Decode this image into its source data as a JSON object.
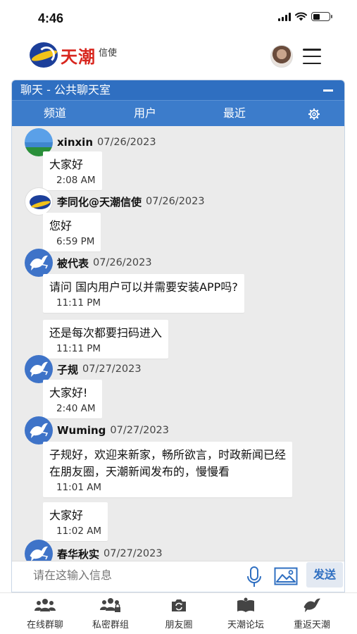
{
  "status_bar": {
    "time": "4:46"
  },
  "header": {
    "logo_text": "天潮",
    "logo_sub": "信使"
  },
  "panel": {
    "title": "聊天 - 公共聊天室",
    "tabs": [
      {
        "label": "频道"
      },
      {
        "label": "用户"
      },
      {
        "label": "最近"
      }
    ]
  },
  "messages": [
    {
      "author": "xinxin",
      "date": "07/26/2023",
      "text": "大家好",
      "time": "2:08 AM",
      "avatar": "landscape-avatar"
    },
    {
      "author": "李同化@天潮信使",
      "date": "07/26/2023",
      "text": "您好",
      "time": "6:59 PM",
      "avatar": "tianchao-logo-avatar"
    },
    {
      "author": "被代表",
      "date": "07/26/2023",
      "text": "请问 国内用户可以并需要安装APP吗?",
      "time": "11:11 PM",
      "avatar": "dove-avatar"
    },
    {
      "author": "",
      "date": "",
      "text": "还是每次都要扫码进入",
      "time": "11:11 PM",
      "avatar": ""
    },
    {
      "author": "子规",
      "date": "07/27/2023",
      "text": "大家好!",
      "time": "2:40 AM",
      "avatar": "dove-avatar"
    },
    {
      "author": "Wuming",
      "date": "07/27/2023",
      "text_lines": [
        "子规好，欢迎来新家，畅所欲言，时政新闻已经",
        "在朋友圈，天潮新闻发布的，慢慢看"
      ],
      "time": "11:01 AM",
      "avatar": "dove-avatar"
    },
    {
      "author": "",
      "date": "",
      "text": "大家好",
      "time": "11:02 AM",
      "avatar": ""
    },
    {
      "author": "春华秋实",
      "date": "07/27/2023",
      "avatar": "dove-avatar"
    }
  ],
  "composer": {
    "placeholder": "请在这输入信息",
    "send_label": "发送"
  },
  "bottom_nav": [
    {
      "label": "在线群聊",
      "icon": "group-chat-icon"
    },
    {
      "label": "私密群组",
      "icon": "private-group-icon"
    },
    {
      "label": "朋友圈",
      "icon": "moments-camera-icon"
    },
    {
      "label": "天潮论坛",
      "icon": "forum-book-icon"
    },
    {
      "label": "重返天潮",
      "icon": "dove-icon"
    }
  ]
}
